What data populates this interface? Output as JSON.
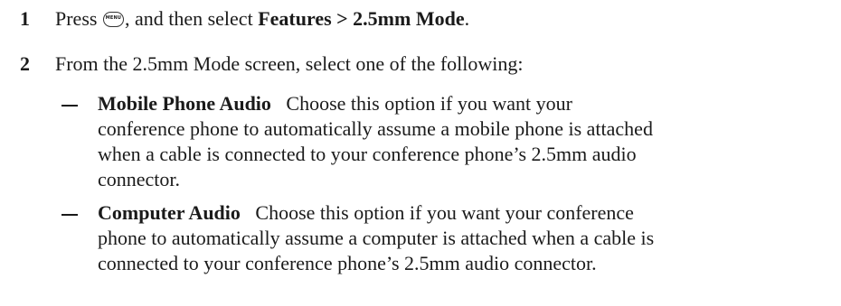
{
  "steps": [
    {
      "number": "1",
      "prefix": "Press ",
      "key_icon_text": "MENU",
      "middle": ", and then select ",
      "path_bold": "Features > 2.5mm Mode",
      "suffix": "."
    },
    {
      "number": "2",
      "text": "From the 2.5mm Mode screen, select one of the following:"
    }
  ],
  "options": [
    {
      "title": "Mobile Phone Audio",
      "line1_rest": "Choose this option if you want your",
      "line2": "conference phone to automatically assume a mobile phone is attached",
      "line3": "when a cable is connected to your conference phone’s 2.5mm audio",
      "line4": "connector."
    },
    {
      "title": "Computer Audio",
      "line1_rest": "Choose this option if you want your conference",
      "line2": "phone to automatically assume a computer is attached when a cable is",
      "line3": "connected to your conference phone’s 2.5mm audio connector."
    }
  ]
}
